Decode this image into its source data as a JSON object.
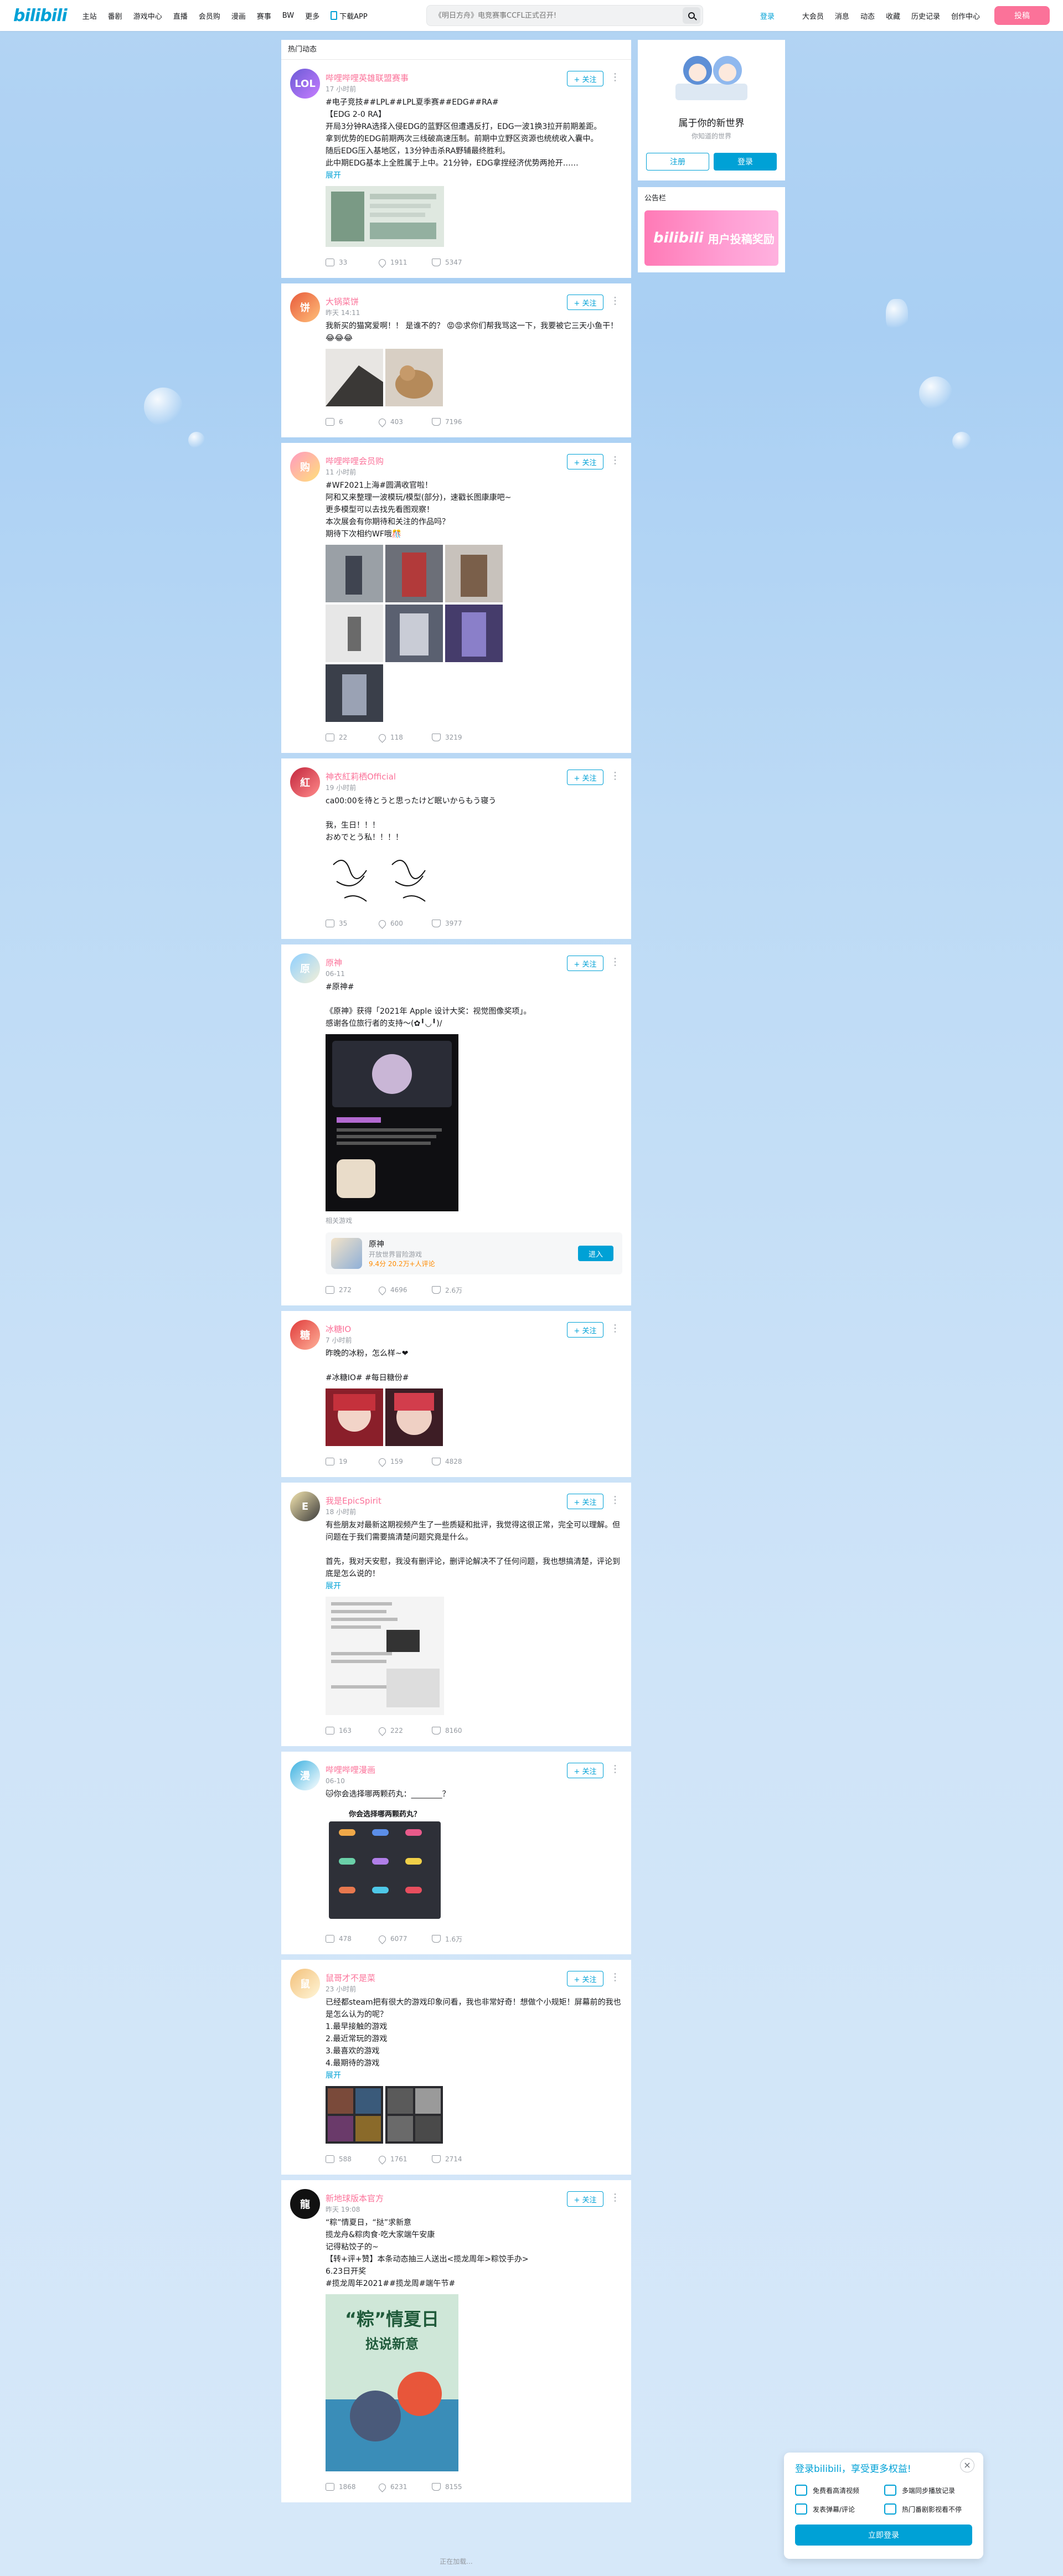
{
  "nav": {
    "logo": "bilibili",
    "left_items": [
      "主站",
      "番剧",
      "游戏中心",
      "直播",
      "会员购",
      "漫画",
      "赛事",
      "BW",
      "更多"
    ],
    "download": "下载APP",
    "search_placeholder": "《明日方舟》电竞赛事CCFL正式召开!",
    "login": "登录",
    "right_items": [
      "大会员",
      "消息",
      "动态",
      "收藏",
      "历史记录",
      "创作中心"
    ],
    "upload": "投稿"
  },
  "main": {
    "header": "热门动态",
    "load_more": "正在加载..."
  },
  "posts": [
    {
      "name": "哔哩哔哩英雄联盟赛事",
      "time": "17 小时前",
      "follow": "+ 关注",
      "text": "#电子竞技##LPL##LPL夏季赛##EDG##RA#\n【EDG 2-0 RA】\n开局3分钟RA选择入侵EDG的蓝野区但遭遇反打，EDG一波1换3拉开前期差距。\n拿到优势的EDG前期两次三线破高速压制。前期中立野区资源也统统收入囊中。\n随后EDG压入基地区，13分钟击杀RA野辅最终胜利。\n此中期EDG基本上全胜属于上中。21分钟，EDG拿捏经济优势两抢开……",
      "expand": "展开",
      "comments": "33",
      "forwards": "1911",
      "likes": "5347"
    },
    {
      "name": "大锅菜饼",
      "time": "昨天 14:11",
      "follow": "+ 关注",
      "text": "我新买的猫窝爱啊！！ 是谁不的？ 😡😡求你们帮我骂这一下，我要被它三天小鱼干！😂😂😂",
      "comments": "6",
      "forwards": "403",
      "likes": "7196"
    },
    {
      "name": "哔哩哔哩会员购",
      "time": "11 小时前",
      "follow": "+ 关注",
      "text": "#WF2021上海#圆满收官啦！\n阿和又来整理一波模玩/模型(部分)，速戳长图康康吧~\n更多模型可以去找先看图观察！\n本次展会有你期待和关注的作品吗？\n期待下次相约WF哦🎊",
      "comments": "22",
      "forwards": "118",
      "likes": "3219"
    },
    {
      "name": "神衣紅莉栖Official",
      "time": "19 小时前",
      "follow": "+ 关注",
      "text": "ca00:00を待とうと思ったけど眠いからもう寝う\n\n我，生日！！！\nおめでとう私！！！！",
      "comments": "35",
      "forwards": "600",
      "likes": "3977"
    },
    {
      "name": "原神",
      "time": "06-11",
      "follow": "+ 关注",
      "text": "#原神#\n\n《原神》获得「2021年 Apple 设计大奖：视觉图像奖项」。\n感谢各位旅行者的支持～(✿╹◡╹)/",
      "game_label": "相关游戏",
      "game_title": "原神",
      "game_desc": "开放世界冒险游戏",
      "game_score": "9.4分 20.2万+人评论",
      "game_btn": "进入",
      "comments": "272",
      "forwards": "4696",
      "likes": "2.6万"
    },
    {
      "name": "冰糖IO",
      "time": "7 小时前",
      "follow": "+ 关注",
      "text": "昨晚的冰粉，怎么样~❤\n\n#冰糖IO# #每日糖份#",
      "comments": "19",
      "forwards": "159",
      "likes": "4828"
    },
    {
      "name": "我是EpicSpirit",
      "time": "18 小时前",
      "follow": "+ 关注",
      "text": "有些朋友对最新这期视频产生了一些质疑和批评，我觉得这很正常，完全可以理解。但问题在于我们需要搞清楚问题究竟是什么。\n\n首先，我对天安慰，我没有删评论，删评论解决不了任何问题，我也想搞清楚，评论到底是怎么说的！",
      "expand": "展开",
      "comments": "163",
      "forwards": "222",
      "likes": "8160"
    },
    {
      "name": "哔哩哔哩漫画",
      "time": "06-10",
      "follow": "+ 关注",
      "text": "🐱你会选择哪两颗药丸：________？",
      "pill_title": "你会选择哪两颗药丸？",
      "comments": "478",
      "forwards": "6077",
      "likes": "1.6万"
    },
    {
      "name": "鼠哥才不是菜",
      "time": "23 小时前",
      "follow": "+ 关注",
      "text": "已经都steam把有很大的游戏印象问看，我也非常好奇！想做个小规矩！屏幕前的我也是怎么认为的呢？\n1.最早接触的游戏\n2.最近常玩的游戏\n3.最喜欢的游戏\n4.最期待的游戏",
      "expand": "展开",
      "comments": "588",
      "forwards": "1761",
      "likes": "2714"
    },
    {
      "name": "新地球版本官方",
      "time": "昨天 19:08",
      "follow": "+ 关注",
      "text": "“粽”情夏日，“挞”求新意\n揽龙舟&粽肉食·吃大家端午安康\n记得粘饺子的~\n【转+评+赞】本条动态抽三人送出<揽龙周年>粽饺手办>\n6.23日开奖\n#揽龙周年2021##揽龙周#端午节#",
      "poster_line1": "“粽”情夏日",
      "poster_line2": "挞说新意",
      "comments": "1868",
      "forwards": "6231",
      "likes": "8155"
    }
  ],
  "sidebar": {
    "title": "属于你的新世界",
    "subtitle": "你知道的世界",
    "register": "注册",
    "login": "登录",
    "notice_title": "公告栏",
    "notice_banner": "用户投稿奖励"
  },
  "popup": {
    "title": "登录bilibili，享受更多权益!",
    "close": "×",
    "items": [
      "免费看高清视频",
      "多端同步播放记录",
      "发表弹幕/评论",
      "热门番剧影视看不停"
    ],
    "button": "立即登录"
  },
  "colors": {
    "brand_blue": "#00a1d6",
    "brand_pink": "#fb7299"
  }
}
